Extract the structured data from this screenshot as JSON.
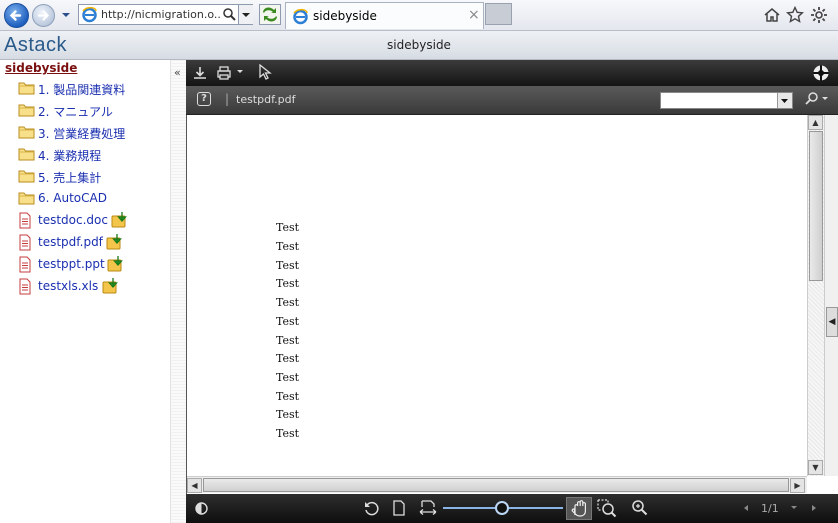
{
  "browser": {
    "address": "http://nicmigration.o...",
    "tab_title": "sidebyside"
  },
  "app": {
    "logo": "Astack",
    "title": "sidebyside"
  },
  "sidebar": {
    "collapse": "«",
    "root": "sidebyside",
    "folders": [
      {
        "label": "1. 製品関連資料"
      },
      {
        "label": "2. マニュアル"
      },
      {
        "label": "3. 営業経費処理"
      },
      {
        "label": "4. 業務規程"
      },
      {
        "label": "5. 売上集計"
      },
      {
        "label": "6. AutoCAD"
      }
    ],
    "files": [
      {
        "label": "testdoc.doc"
      },
      {
        "label": "testpdf.pdf"
      },
      {
        "label": "testppt.ppt"
      },
      {
        "label": "testxls.xls"
      }
    ]
  },
  "viewer": {
    "help": "?",
    "separator": "|",
    "document_name": "testpdf.pdf",
    "page_select_value": "",
    "page_indicator": "1/1",
    "content_lines": [
      "Test",
      "Test",
      "Test",
      "Test",
      "Test",
      "Test",
      "Test",
      "Test",
      "Test",
      "Test",
      "Test",
      "Test"
    ]
  },
  "colors": {
    "link": "#1a2fb0",
    "root_link": "#7a1010",
    "toolbar_dark": "#1a1a1a",
    "accent": "#8ab4e6"
  }
}
